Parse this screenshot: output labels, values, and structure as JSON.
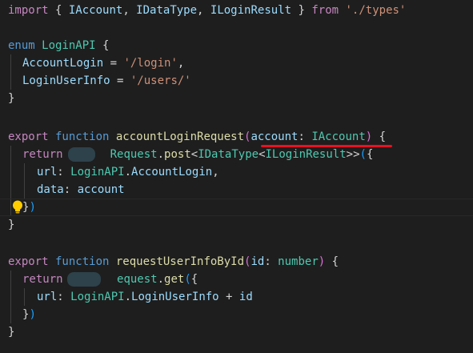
{
  "code": {
    "l1": {
      "kw": "import",
      "p1": " { ",
      "t1": "IAccount",
      "c1": ", ",
      "t2": "IDataType",
      "c2": ", ",
      "t3": "ILoginResult",
      "p2": " } ",
      "kw2": "from",
      "s": " './types'"
    },
    "l3": {
      "kw": "enum",
      "sp": " ",
      "name": "LoginAPI",
      "br": " {"
    },
    "l4": {
      "name": "AccountLogin",
      "eq": " = ",
      "s": "'/login'",
      "c": ","
    },
    "l5": {
      "name": "LoginUserInfo",
      "eq": " = ",
      "s": "'/users/'"
    },
    "l6": {
      "br": "}"
    },
    "l8": {
      "kw1": "export",
      "kw2": " function",
      "fn": " accountLoginRequest",
      "p1": "(",
      "arg": "account",
      "col": ": ",
      "type": "IAccount",
      "p2": ")",
      "br": " {"
    },
    "l9": {
      "ret": "return",
      "obj": "Request",
      "dot": ".",
      "fn": "post",
      "lt": "<",
      "t1": "IDataType",
      "lt2": "<",
      "t2": "ILoginResult",
      "gt": ">>",
      "p": "(",
      "b": "{"
    },
    "l10": {
      "k": "url",
      "col": ": ",
      "obj": "LoginAPI",
      "dot": ".",
      "prop": "AccountLogin",
      "c": ","
    },
    "l11": {
      "k": "data",
      "col": ": ",
      "v": "account"
    },
    "l12": {
      "b": "}",
      "p": ")"
    },
    "l13": {
      "br": "}"
    },
    "l15": {
      "kw1": "export",
      "kw2": " function",
      "fn": " requestUserInfoById",
      "p1": "(",
      "arg": "id",
      "col": ": ",
      "type": "number",
      "p2": ")",
      "br": " {"
    },
    "l16": {
      "ret": "return",
      "obj": "equest",
      "dot": ".",
      "fn": "get",
      "p": "(",
      "b": "{"
    },
    "l17": {
      "k": "url",
      "col": ": ",
      "obj": "LoginAPI",
      "dot": ".",
      "prop": "LoginUserInfo",
      "plus": " + ",
      "v": "id"
    },
    "l18": {
      "b": "}",
      "p": ")"
    },
    "l19": {
      "br": "}"
    }
  },
  "icons": {
    "lightbulb": "lightbulb-icon"
  },
  "colors": {
    "background": "#1e1e1e",
    "keyword_control": "#c586c0",
    "keyword": "#569cd6",
    "type": "#4ec9b0",
    "function": "#dcdcaa",
    "variable": "#9cdcfe",
    "string": "#ce9178",
    "underline": "#e81123",
    "lightbulb": "#ffcc00"
  }
}
